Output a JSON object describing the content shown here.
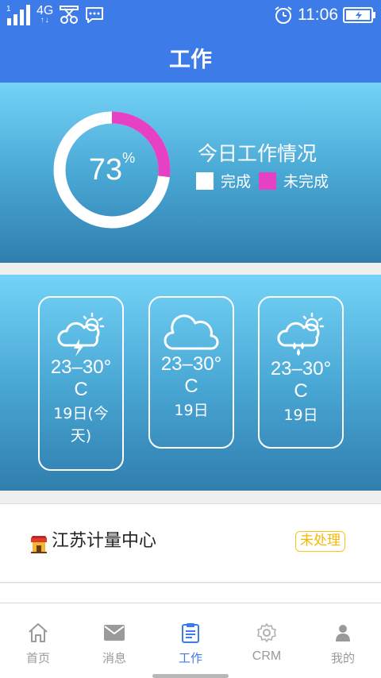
{
  "status_bar": {
    "sim_slot": "1",
    "network": "4G",
    "network_arrows": "↑↓",
    "time": "11:06",
    "icons": [
      "signal-icon",
      "network-4g-icon",
      "scissors-icon",
      "message-icon",
      "alarm-icon",
      "battery-charging-icon"
    ]
  },
  "header": {
    "title": "工作"
  },
  "work_summary": {
    "percent": 73,
    "percent_value": "73",
    "percent_unit": "%",
    "title": "今日工作情况",
    "legend": [
      {
        "label": "完成",
        "color": "#ffffff"
      },
      {
        "label": "未完成",
        "color": "#e640c4"
      }
    ]
  },
  "weather": [
    {
      "icon": "thunder-sun-cloud-icon",
      "temp": "23–30° C",
      "day": "19日(今天)"
    },
    {
      "icon": "cloud-icon",
      "temp": "23–30° C",
      "day": "19日"
    },
    {
      "icon": "rain-sun-cloud-icon",
      "temp": "23–30° C",
      "day": "19日"
    }
  ],
  "task": {
    "icon": "shop-icon",
    "title": "江苏计量中心",
    "status": "未处理"
  },
  "nav": [
    {
      "label": "首页",
      "icon": "home-icon",
      "active": false
    },
    {
      "label": "消息",
      "icon": "mail-icon",
      "active": false
    },
    {
      "label": "工作",
      "icon": "clipboard-icon",
      "active": true
    },
    {
      "label": "CRM",
      "icon": "gear-icon",
      "active": false
    },
    {
      "label": "我的",
      "icon": "user-icon",
      "active": false
    }
  ],
  "colors": {
    "primary": "#3d7be8",
    "incomplete": "#e640c4",
    "badge": "#f5c518"
  }
}
